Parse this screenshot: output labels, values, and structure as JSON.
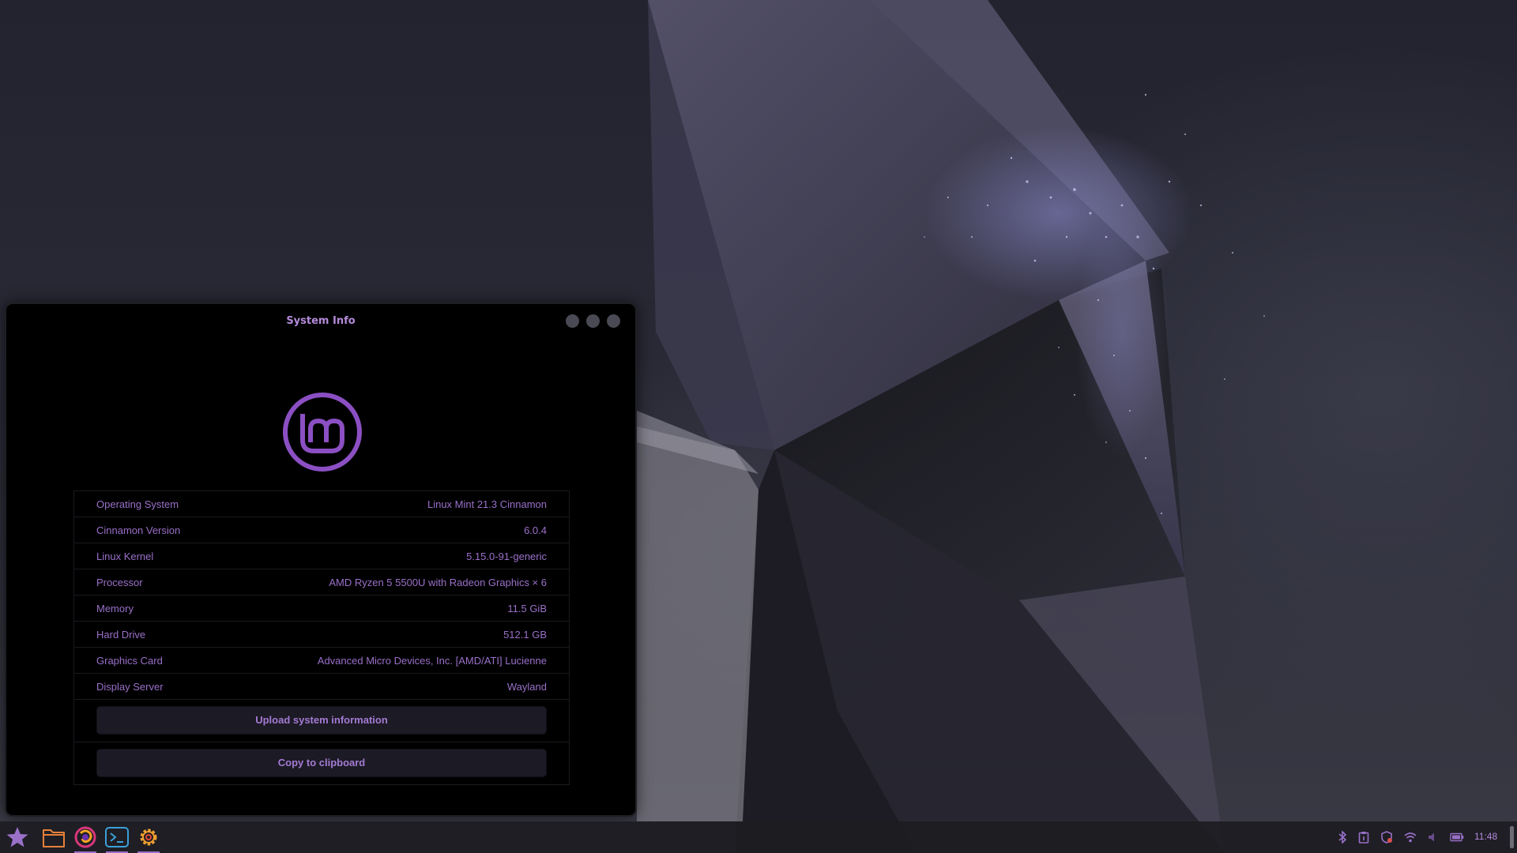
{
  "window": {
    "title": "System Info",
    "controls": [
      "minimize",
      "maximize",
      "close"
    ]
  },
  "logo": {
    "icon": "linux-mint-logo-icon",
    "color": "#8b4fc3"
  },
  "system_info": [
    {
      "key": "Operating System",
      "value": "Linux Mint 21.3 Cinnamon"
    },
    {
      "key": "Cinnamon Version",
      "value": "6.0.4"
    },
    {
      "key": "Linux Kernel",
      "value": "5.15.0-91-generic"
    },
    {
      "key": "Processor",
      "value": "AMD Ryzen 5 5500U with Radeon Graphics × 6"
    },
    {
      "key": "Memory",
      "value": "11.5 GiB"
    },
    {
      "key": "Hard Drive",
      "value": "512.1 GB"
    },
    {
      "key": "Graphics Card",
      "value": "Advanced Micro Devices, Inc. [AMD/ATI] Lucienne"
    },
    {
      "key": "Display Server",
      "value": "Wayland"
    }
  ],
  "actions": {
    "upload_label": "Upload system information",
    "copy_label": "Copy to clipboard"
  },
  "panel": {
    "launchers": [
      {
        "icon": "star-menu-icon"
      },
      {
        "icon": "folder-icon"
      },
      {
        "icon": "firefox-icon",
        "running": true
      },
      {
        "icon": "terminal-icon",
        "running": true
      },
      {
        "icon": "settings-gear-icon",
        "running": true
      }
    ],
    "tray": [
      "bluetooth-icon",
      "clipboard-icon",
      "shield-update-icon",
      "wifi-icon",
      "volume-icon",
      "battery-icon"
    ],
    "clock": "11:48"
  },
  "colors": {
    "accent": "#9a70c9",
    "window_bg": "#000000",
    "button_bg": "#1c1a24",
    "panel_bg": "#1c1c22"
  }
}
